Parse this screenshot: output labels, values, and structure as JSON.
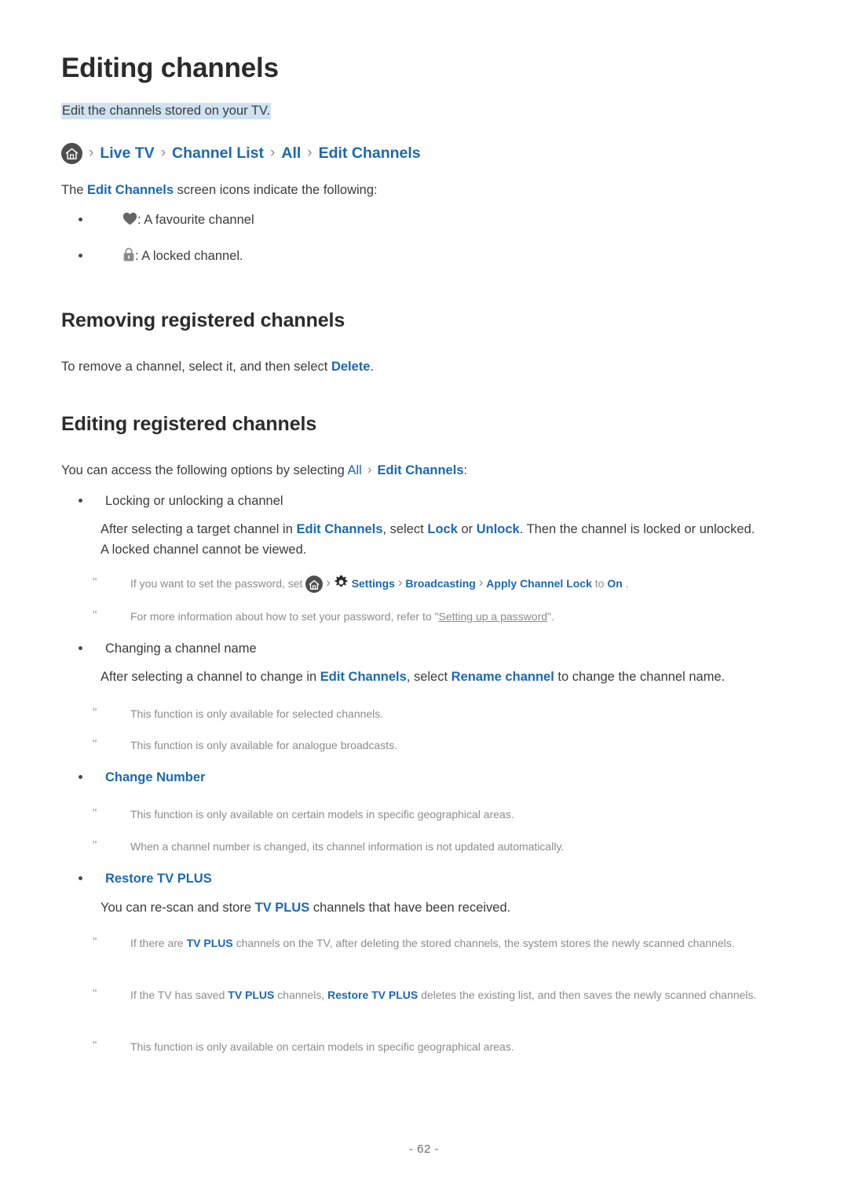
{
  "document": {
    "title": "Editing channels",
    "description": "Edit the channels stored on your TV.",
    "page_number": "- 62 -",
    "accent_color": "#1c68b0",
    "highlight_color": "#cfe2f0",
    "text_color": "#3c3c3c",
    "note_color": "#8c8c8c"
  },
  "breadcrumb": {
    "home_icon": "home-icon",
    "separator": "›",
    "items": [
      "Live TV",
      "Channel List",
      "All",
      "Edit Channels"
    ]
  },
  "intro": {
    "lead_before": "The ",
    "lead_link": "Edit Channels",
    "lead_after": " screen icons indicate the following:",
    "icon_items": [
      {
        "icon": "heart-icon",
        "text": ": A favourite channel"
      },
      {
        "icon": "lock-icon",
        "text": ": A locked channel."
      }
    ]
  },
  "sections": [
    {
      "heading": "Removing registered channels",
      "body_before": "To remove a channel, select it, and then select ",
      "body_link": "Delete",
      "body_after": "."
    },
    {
      "heading": "Editing registered channels",
      "intro_before": "You can access the following options by selecting ",
      "intro_link_1": "All",
      "intro_sep": "›",
      "intro_link_2": "Edit Channels",
      "intro_after": ":"
    }
  ],
  "options": {
    "locking": {
      "label": "Locking or unlocking a channel",
      "body": [
        "After selecting a target channel in ",
        "Edit Channels",
        ", select ",
        "Lock",
        " or ",
        "Unlock",
        ". Then the channel is locked or unlocked. A locked channel cannot be viewed."
      ],
      "notes": [
        {
          "prefix": "If you want to set the password, set ",
          "home_icon": "home-icon",
          "sep": "›",
          "gear_icon": "gear-icon",
          "path": [
            "Settings",
            "Broadcasting",
            "Apply Channel Lock"
          ],
          "middle": " to ",
          "value": "On",
          "suffix": "."
        },
        {
          "text_before": "For more information about how to set your password, refer to \"",
          "link": "Setting up a password",
          "text_after": "\"."
        }
      ]
    },
    "renaming": {
      "label": "Changing a channel name",
      "body": [
        "After selecting a channel to change in ",
        "Edit Channels",
        ", select ",
        "Rename channel",
        " to change the channel name."
      ],
      "notes": [
        "This function is only available for selected channels.",
        "This function is only available for analogue broadcasts."
      ]
    },
    "change_number": {
      "label": "Change Number",
      "notes": [
        "This function is only available on certain models in specific geographical areas.",
        "When a channel number is changed, its channel information is not updated automatically."
      ]
    },
    "restore_tv_plus": {
      "label": "Restore TV PLUS",
      "body": [
        "You can re-scan and store ",
        "TV PLUS",
        " channels that have been received."
      ],
      "notes": [
        {
          "parts": [
            "If there are ",
            "TV PLUS",
            " channels on the TV, after deleting the stored channels, the system stores the newly scanned channels."
          ]
        },
        {
          "parts": [
            "If the TV has saved ",
            "TV PLUS",
            " channels, ",
            "Restore TV PLUS",
            " deletes the existing list, and then saves the newly scanned channels."
          ]
        },
        {
          "parts": [
            "This function is only available on certain models in specific geographical areas."
          ]
        }
      ]
    }
  }
}
